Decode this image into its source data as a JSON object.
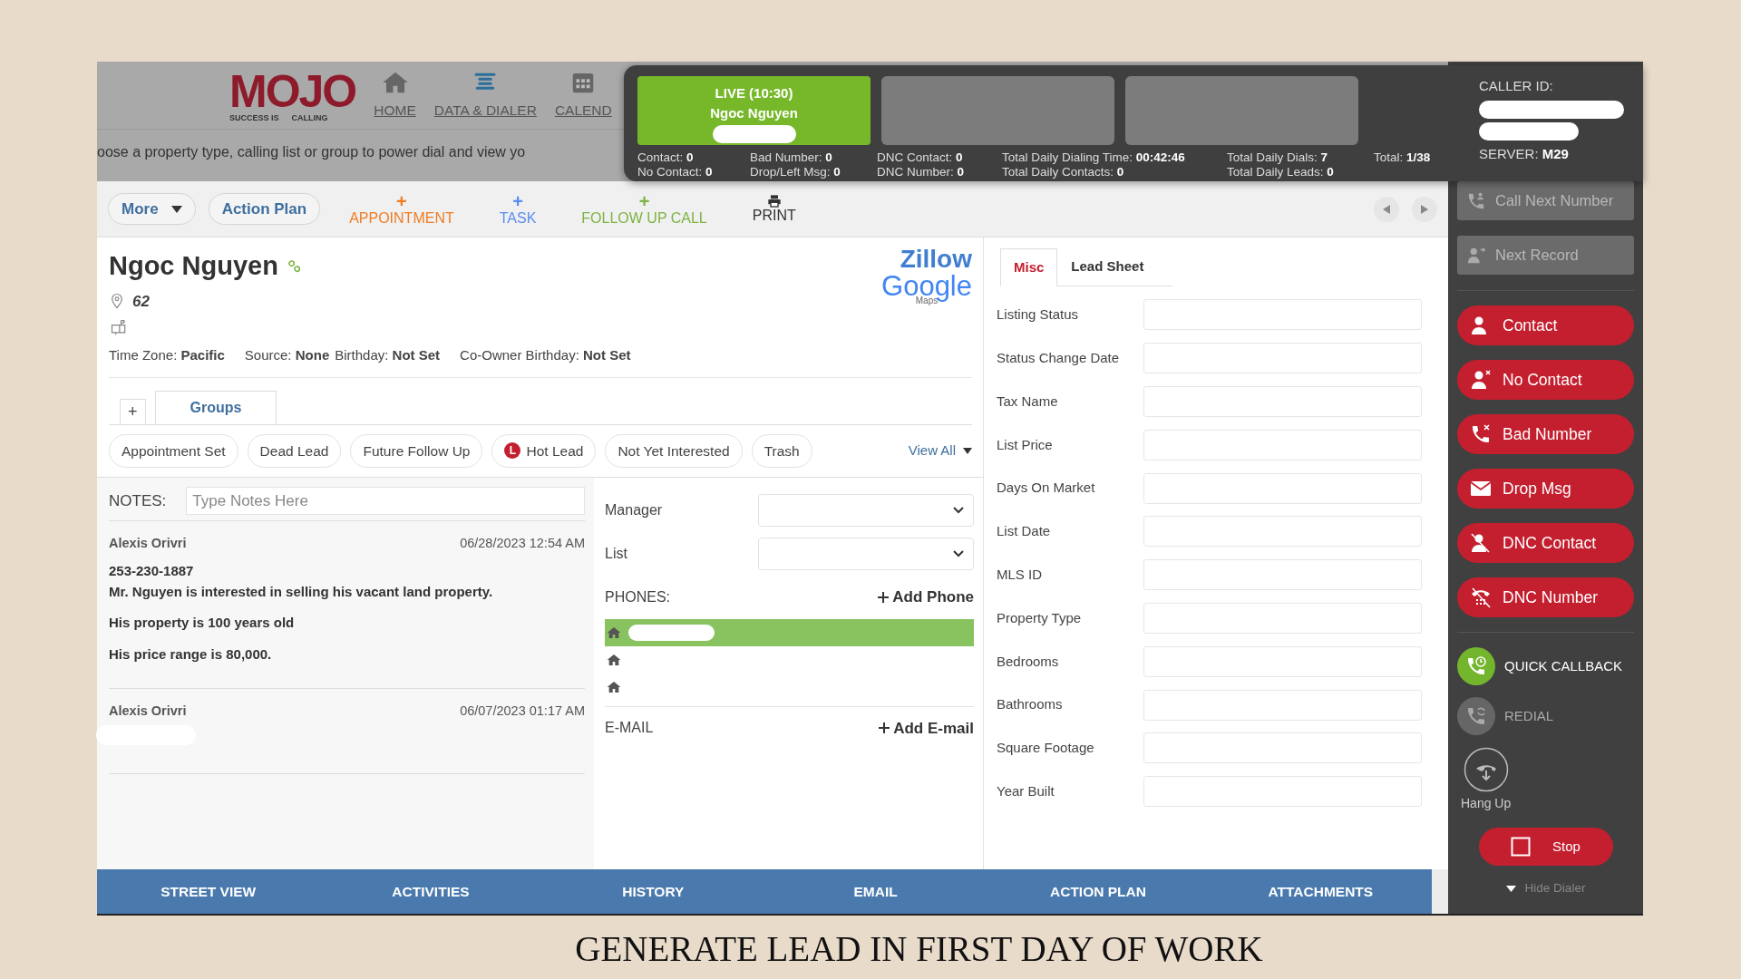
{
  "logo": {
    "word": "MOJO",
    "tagline_left": "SUCCESS IS",
    "tagline_right": "CALLING"
  },
  "nav": [
    {
      "label": "HOME"
    },
    {
      "label": "DATA & DIALER"
    },
    {
      "label": "CALEND"
    }
  ],
  "banner_text": "oose a property type, calling list or group to power dial and view yo",
  "live_call": {
    "status": "LIVE (10:30)",
    "name": "Ngoc Nguyen"
  },
  "stats": [
    [
      {
        "label": "Contact:",
        "value": "0"
      },
      {
        "label": "Bad Number:",
        "value": "0"
      },
      {
        "label": "DNC Contact:",
        "value": "0"
      },
      {
        "label": "Total Daily Dialing Time:",
        "value": "00:42:46"
      },
      {
        "label": "Total Daily Dials:",
        "value": "7"
      },
      {
        "label": "Total:",
        "value": "1/38"
      }
    ],
    [
      {
        "label": "No Contact:",
        "value": "0"
      },
      {
        "label": "Drop/Left Msg:",
        "value": "0"
      },
      {
        "label": "DNC Number:",
        "value": "0"
      },
      {
        "label": "Total Daily Contacts:",
        "value": "0"
      },
      {
        "label": "Total Daily Leads:",
        "value": "0"
      }
    ]
  ],
  "caller_id": {
    "label": "CALLER ID:",
    "server_label": "SERVER:",
    "server": "M29"
  },
  "toolbar": {
    "pills": [
      {
        "label": "More",
        "kind": "dropdown"
      },
      {
        "label": "Action Plan",
        "kind": "plain"
      }
    ],
    "actions": [
      {
        "kind": "add",
        "symbol": "+",
        "label": "APPOINTMENT",
        "color": "#f07c24"
      },
      {
        "kind": "add",
        "symbol": "+",
        "label": "TASK",
        "color": "#5b8def"
      },
      {
        "kind": "add",
        "symbol": "+",
        "label": "FOLLOW UP CALL",
        "color": "#7cb342"
      },
      {
        "kind": "print",
        "label": "PRINT",
        "color": "#333333"
      }
    ]
  },
  "lead": {
    "name": "Ngoc Nguyen",
    "address": "62",
    "meta": [
      {
        "label": "Time Zone:",
        "value": "Pacific"
      },
      {
        "label": "Source:",
        "value": "None"
      },
      {
        "label": "Birthday:",
        "value": "Not Set"
      },
      {
        "label": "Co-Owner Birthday:",
        "value": "Not Set"
      }
    ],
    "zillow": "Zillow",
    "google": "Google",
    "maps": "Maps"
  },
  "group_tabs": [
    {
      "label": "+",
      "selected": false
    },
    {
      "label": "Groups",
      "selected": true
    }
  ],
  "groups": [
    {
      "label": "Appointment Set"
    },
    {
      "label": "Dead Lead"
    },
    {
      "label": "Future Follow Up"
    },
    {
      "label": "Hot Lead",
      "marker": "L"
    },
    {
      "label": "Not Yet Interested"
    },
    {
      "label": "Trash"
    }
  ],
  "view_all": "View All",
  "notes": {
    "label": "NOTES:",
    "placeholder": "Type Notes Here",
    "entries": [
      {
        "author": "Alexis Orivri",
        "date": "06/28/2023 12:54 AM",
        "paragraphs": [
          [
            "253-230-1887",
            "Mr. Nguyen is interested in selling his vacant land property."
          ],
          [
            "His property is 100 years old"
          ],
          [
            "His price range is 80,000."
          ]
        ]
      },
      {
        "author": "Alexis Orivri",
        "date": "06/07/2023 01:17 AM"
      }
    ]
  },
  "assign": [
    {
      "label": "Manager"
    },
    {
      "label": "List"
    }
  ],
  "phones": {
    "label": "PHONES:",
    "add": "Add Phone",
    "items": [
      {
        "selected": true
      },
      {
        "selected": false
      },
      {
        "selected": false
      }
    ]
  },
  "email": {
    "label": "E-MAIL",
    "add": "Add E-mail"
  },
  "misc_tabs": [
    {
      "label": "Misc",
      "selected": true
    },
    {
      "label": "Lead Sheet",
      "selected": false
    }
  ],
  "misc_fields": [
    "Listing Status",
    "Status Change Date",
    "Tax Name",
    "List Price",
    "Days On Market",
    "List Date",
    "MLS ID",
    "Property Type",
    "Bedrooms",
    "Bathrooms",
    "Square Footage",
    "Year Built"
  ],
  "bottom_tabs": [
    "STREET VIEW",
    "ACTIVITIES",
    "HISTORY",
    "EMAIL",
    "ACTION PLAN",
    "ATTACHMENTS"
  ],
  "dialer_actions": [
    {
      "kind": "box",
      "label": "Call Next Number",
      "disabled": true
    },
    {
      "kind": "box",
      "label": "Next Record",
      "disabled": true
    },
    {
      "kind": "pill",
      "label": "Contact"
    },
    {
      "kind": "pill",
      "label": "No Contact"
    },
    {
      "kind": "pill",
      "label": "Bad Number"
    },
    {
      "kind": "pill",
      "label": "Drop Msg"
    },
    {
      "kind": "pill",
      "label": "DNC Contact"
    },
    {
      "kind": "pill",
      "label": "DNC Number"
    },
    {
      "kind": "circle",
      "label": "QUICK CALLBACK",
      "disabled": false
    },
    {
      "kind": "circle",
      "label": "REDIAL",
      "disabled": true
    }
  ],
  "hang_up": "Hang Up",
  "stop": "Stop",
  "hide_dialer": "Hide Dialer",
  "caption": "GENERATE LEAD IN FIRST DAY OF WORK"
}
